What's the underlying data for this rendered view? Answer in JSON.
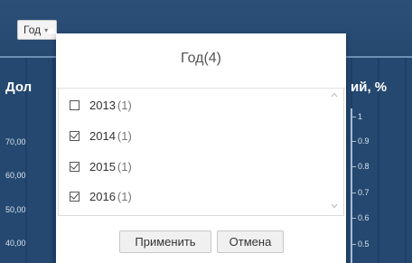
{
  "filter_button": {
    "label": "Год",
    "caret": "▾"
  },
  "background": {
    "left_title": "Дол",
    "right_title": "ий, %",
    "left_ticks": [
      "70,00",
      "60,00",
      "50,00",
      "40,00"
    ],
    "right_ticks": [
      "1",
      "0.9",
      "0.8",
      "0.7",
      "0.6",
      "0.5"
    ]
  },
  "popup": {
    "title": "Год",
    "title_count": "(4)",
    "items": [
      {
        "label": "2013",
        "count": "(1)",
        "checked": false
      },
      {
        "label": "2014",
        "count": "(1)",
        "checked": true
      },
      {
        "label": "2015",
        "count": "(1)",
        "checked": true
      },
      {
        "label": "2016",
        "count": "(1)",
        "checked": true
      }
    ],
    "apply_label": "Применить",
    "cancel_label": "Отмена"
  },
  "icons": {
    "caret": "chevron-down-icon",
    "scroll_up": "chevron-up-icon",
    "scroll_down": "chevron-down-icon"
  }
}
